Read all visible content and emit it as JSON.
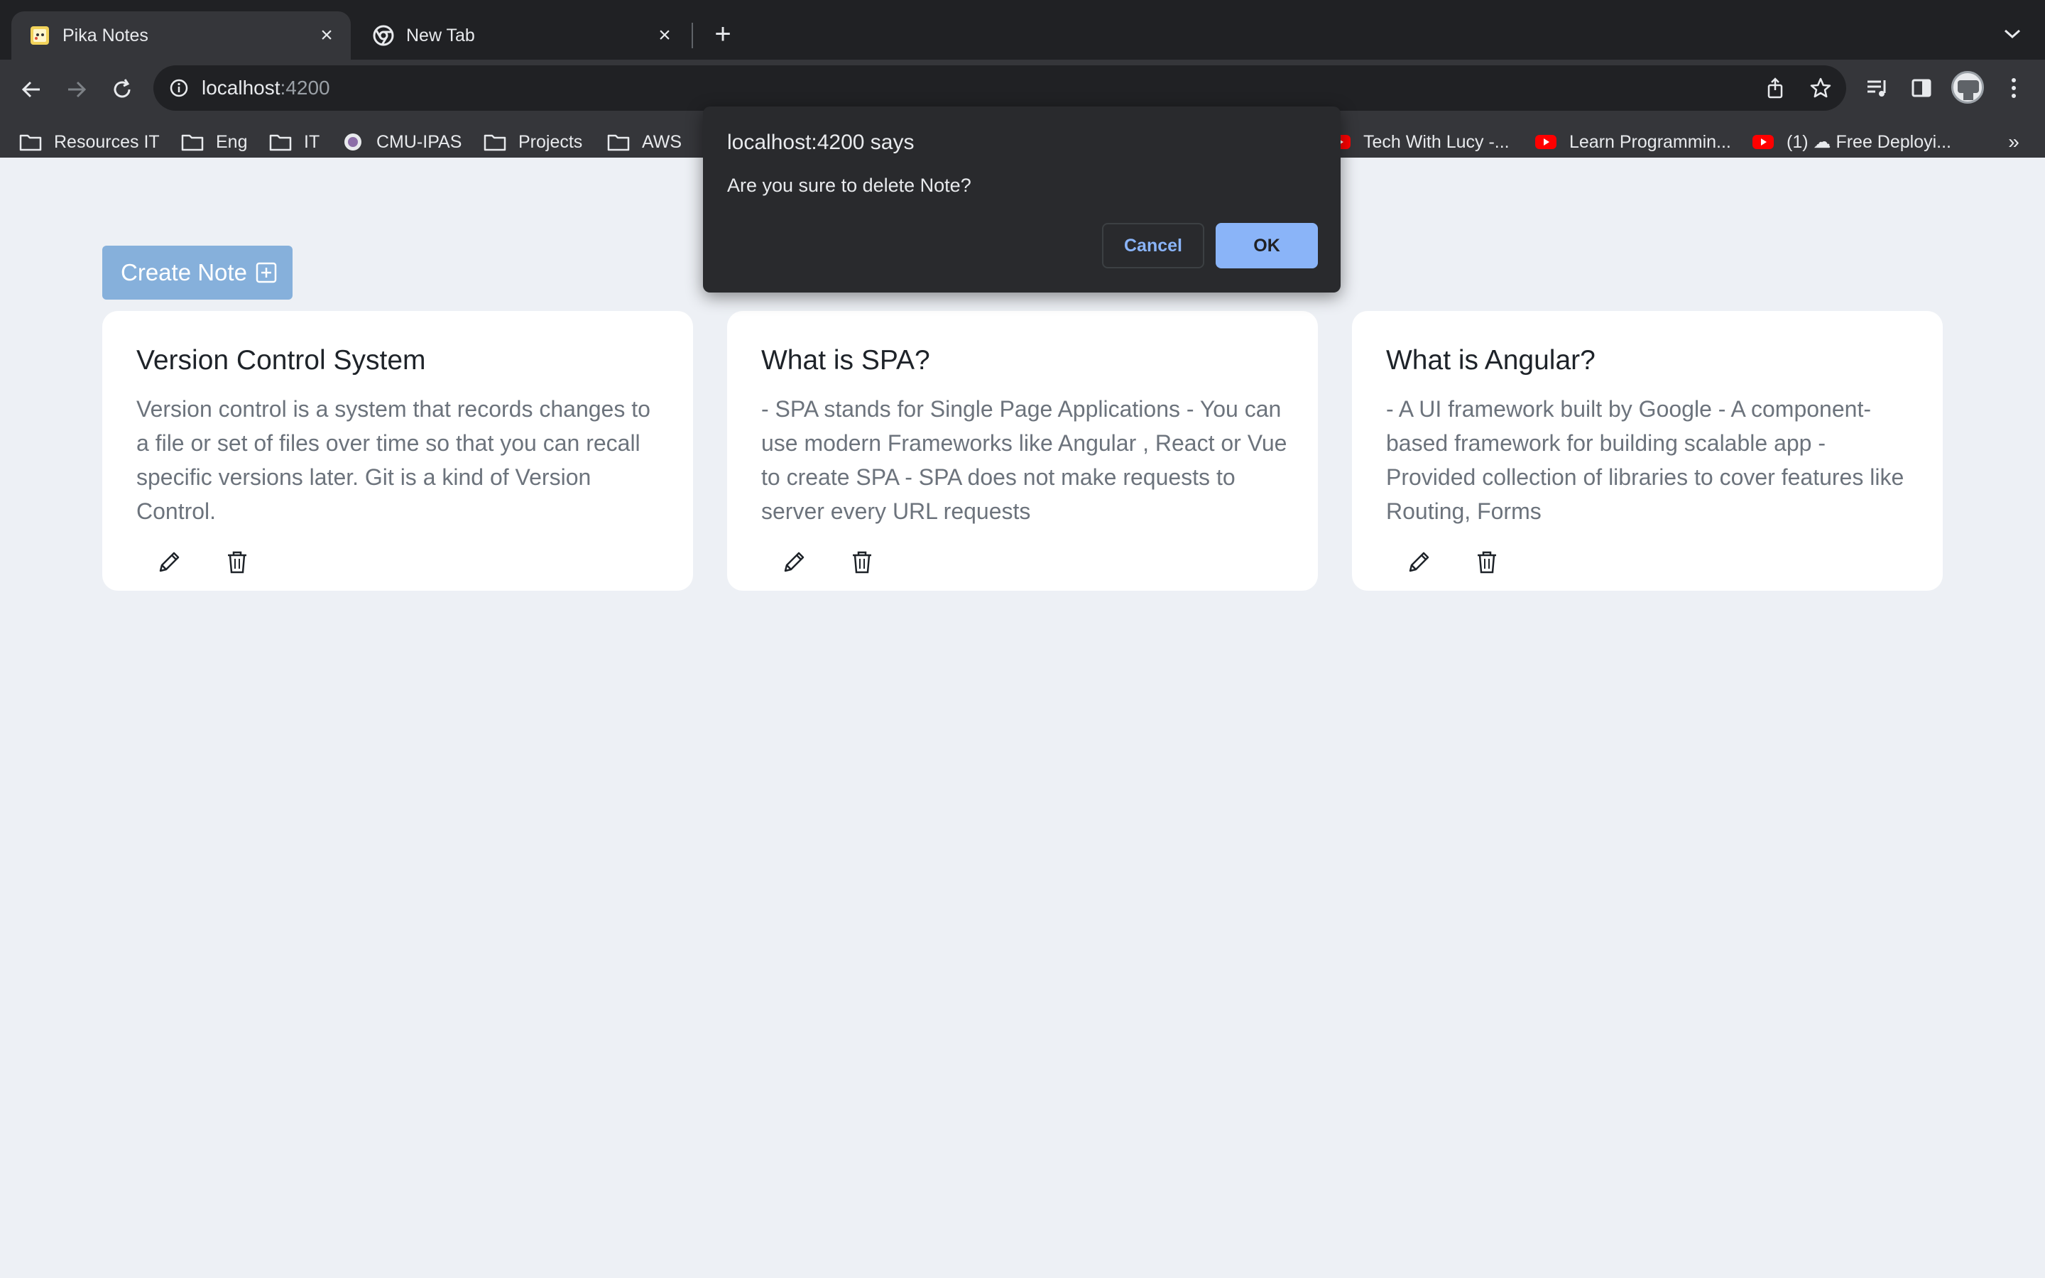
{
  "browser": {
    "tabs": [
      {
        "title": "Pika Notes",
        "active": true,
        "favicon": "pika-favicon-icon"
      },
      {
        "title": "New Tab",
        "active": false,
        "favicon": "chrome-icon"
      }
    ],
    "url_host": "localhost",
    "url_port": ":4200",
    "bookmarks": [
      {
        "label": "Resources IT",
        "icon": "folder-icon"
      },
      {
        "label": "Eng",
        "icon": "folder-icon"
      },
      {
        "label": "IT",
        "icon": "folder-icon"
      },
      {
        "label": "CMU-IPAS",
        "icon": "site-icon"
      },
      {
        "label": "Projects",
        "icon": "folder-icon"
      },
      {
        "label": "AWS",
        "icon": "folder-icon"
      },
      {
        "label": "Tech With Lucy -...",
        "icon": "youtube-icon"
      },
      {
        "label": "Learn Programmin...",
        "icon": "youtube-icon"
      },
      {
        "label": "(1) ☁ Free Deployi...",
        "icon": "youtube-icon"
      }
    ],
    "bookmarks_more": "»"
  },
  "page": {
    "create_button_label": "Create Note",
    "notes": [
      {
        "title": "Version Control System",
        "body": "Version control is a system that records changes to a file or set of files over time so that you can recall specific versions later. Git is a kind of Version Control."
      },
      {
        "title": "What is SPA?",
        "body": "- SPA stands for Single Page Applications - You can use modern Frameworks like Angular , React or Vue to create SPA - SPA does not make requests to server every URL requests"
      },
      {
        "title": "What is Angular?",
        "body": "- A UI framework built by Google - A component-based framework for building scalable app - Provided collection of libraries to cover features like Routing, Forms"
      }
    ]
  },
  "dialog": {
    "title": "localhost:4200 says",
    "message": "Are you sure to delete Note?",
    "cancel_label": "Cancel",
    "ok_label": "OK"
  },
  "colors": {
    "page_bg": "#edf0f5",
    "create_button_bg": "#86b0db",
    "dialog_bg": "#292a2d",
    "ok_button_bg": "#8ab4f8",
    "chrome_dark": "#202124",
    "chrome_toolbar": "#35363a"
  }
}
